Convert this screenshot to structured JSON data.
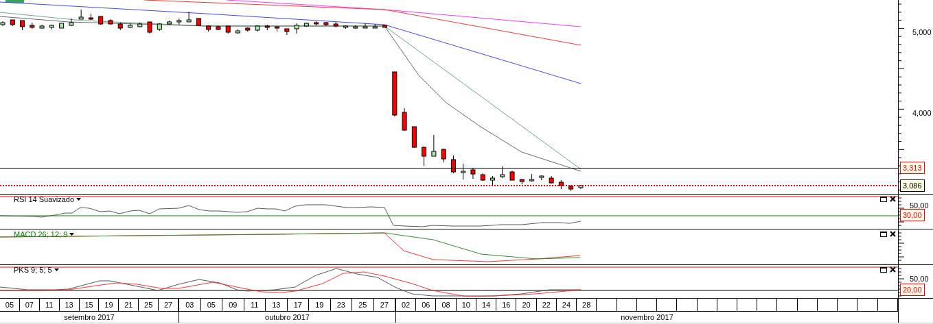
{
  "price_axis": {
    "ticks": [
      "5,000",
      "4,000"
    ],
    "markers": [
      {
        "kind": "resistance",
        "text": "3,313"
      },
      {
        "kind": "last",
        "text": "3,086"
      }
    ]
  },
  "panels": [
    {
      "kind": "rsi",
      "label": "RSI 14 Suavizado",
      "axis_tick": "50,00",
      "marker": "30,00"
    },
    {
      "kind": "macd",
      "label": "MACD 26; 12; 9"
    },
    {
      "kind": "pks",
      "label": "PKS 9; 5; 5",
      "axis_tick": "50,00",
      "marker": "20,00"
    }
  ],
  "date_axis": {
    "months": [
      {
        "label": "setembro 2017",
        "days": [
          "05",
          "07",
          "11",
          "13",
          "15",
          "19",
          "21",
          "25",
          "27"
        ]
      },
      {
        "label": "outubro 2017",
        "days": [
          "03",
          "05",
          "09",
          "11",
          "13",
          "17",
          "19",
          "23",
          "25",
          "27"
        ]
      },
      {
        "label": "novembro 2017",
        "days": [
          "02",
          "06",
          "08",
          "10",
          "14",
          "16",
          "20",
          "22",
          "24",
          "28"
        ]
      }
    ]
  }
}
